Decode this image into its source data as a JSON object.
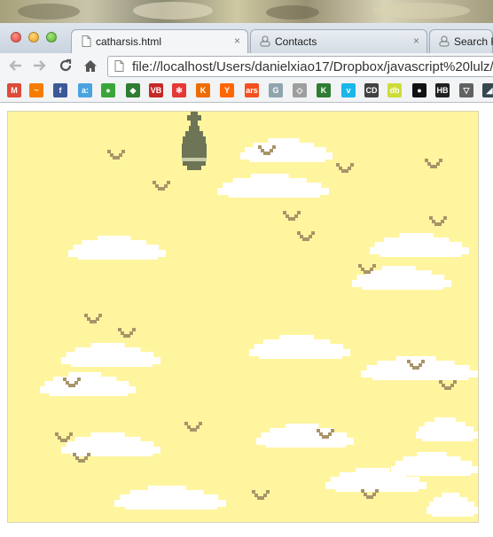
{
  "browser": {
    "tabs": [
      {
        "label": "catharsis.html",
        "icon": "page-icon",
        "active": true
      },
      {
        "label": "Contacts",
        "icon": "contacts-icon",
        "active": false
      },
      {
        "label": "Search R",
        "icon": "contacts-icon",
        "active": false
      }
    ],
    "tab_close_glyph": "×",
    "url": "file://localhost/Users/danielxiao17/Dropbox/javascript%20lulz/",
    "nav": {
      "back": "←",
      "forward": "→",
      "reload": "↻",
      "home": "⌂"
    }
  },
  "bookmarks": [
    {
      "name": "gmail-icon",
      "glyph": "M",
      "color": "#dd4b39"
    },
    {
      "name": "analytics-icon",
      "glyph": "~",
      "color": "#f57c00"
    },
    {
      "name": "facebook-icon",
      "glyph": "f",
      "color": "#3b5998"
    },
    {
      "name": "a-icon",
      "glyph": "a:",
      "color": "#4aa3df"
    },
    {
      "name": "frog-icon",
      "glyph": "●",
      "color": "#3aa63a"
    },
    {
      "name": "green-badge-icon",
      "glyph": "◆",
      "color": "#2e7d32"
    },
    {
      "name": "vb-icon",
      "glyph": "VB",
      "color": "#c62828"
    },
    {
      "name": "asterisk-icon",
      "glyph": "✻",
      "color": "#e53935"
    },
    {
      "name": "k-icon",
      "glyph": "K",
      "color": "#ef6c00"
    },
    {
      "name": "hacker-news-icon",
      "glyph": "Y",
      "color": "#ff6600"
    },
    {
      "name": "ars-icon",
      "glyph": "ars",
      "color": "#f4511e"
    },
    {
      "name": "g-icon",
      "glyph": "G",
      "color": "#90a4ae"
    },
    {
      "name": "diamond-icon",
      "glyph": "◇",
      "color": "#9e9e9e"
    },
    {
      "name": "kickstarter-icon",
      "glyph": "K",
      "color": "#2e7d32"
    },
    {
      "name": "vimeo-icon",
      "glyph": "v",
      "color": "#1ab7ea"
    },
    {
      "name": "cd-icon",
      "glyph": "CD",
      "color": "#424242"
    },
    {
      "name": "db-icon",
      "glyph": "db",
      "color": "#cddc39"
    },
    {
      "name": "dot-icon",
      "glyph": "●",
      "color": "#111111"
    },
    {
      "name": "hb-icon",
      "glyph": "HB",
      "color": "#212121"
    },
    {
      "name": "v-triangle-icon",
      "glyph": "▽",
      "color": "#616161"
    },
    {
      "name": "corner-icon",
      "glyph": "◢",
      "color": "#37474f"
    }
  ],
  "game": {
    "title_of_file": "catharsis.html",
    "colors": {
      "sky": "#fff59f",
      "cloud": "#ffffff",
      "bird": "#a89468",
      "bomb": "#6d7556",
      "bomb_band": "#c8cba8"
    },
    "sprites": {
      "player": "bomb-player",
      "enemies": "bird",
      "scenery": "cloud"
    },
    "bird_count": 24,
    "cloud_count": 15
  }
}
